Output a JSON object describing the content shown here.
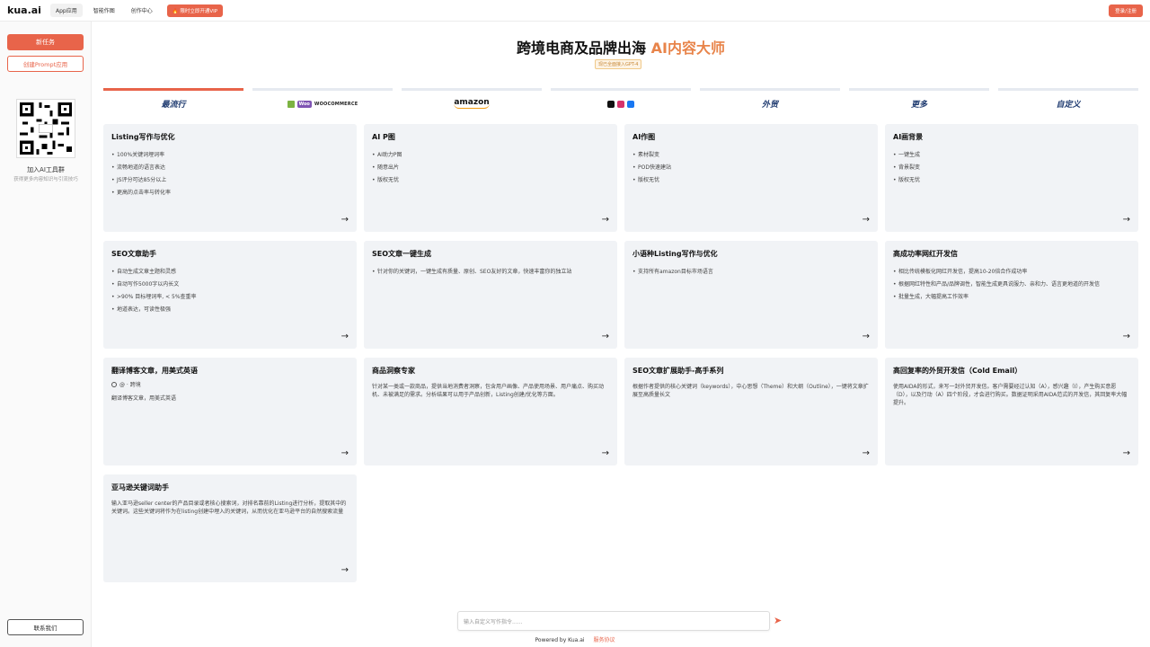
{
  "topbar": {
    "logo": "kua.ai",
    "nav": [
      "App应用",
      "智能作图",
      "创作中心"
    ],
    "vip": "🔥 限时立即开通VIP",
    "login": "登录/注册"
  },
  "sidebar": {
    "new_task": "新任务",
    "create_prompt": "创建Prompt应用",
    "join_title": "加入AI工具群",
    "join_sub": "获得更多内容知识与引流技巧",
    "contact": "联系我们"
  },
  "hero": {
    "title_main": "跨境电商及品牌出海 ",
    "title_accent": "AI内容大师",
    "badge": "现已全面接入GPT-4"
  },
  "tabs": [
    {
      "label": "最流行",
      "icon": "none"
    },
    {
      "label": "WOOCOMMERCE",
      "icon": "woocommerce-logo"
    },
    {
      "label": "amazon",
      "icon": "amazon-logo"
    },
    {
      "label": "",
      "icon": "social-icons"
    },
    {
      "label": "外贸",
      "icon": "none"
    },
    {
      "label": "更多",
      "icon": "none"
    },
    {
      "label": "自定义",
      "icon": "none"
    }
  ],
  "cards": [
    {
      "title": "Listing写作与优化",
      "bullets": [
        "100%关键词埋词率",
        "流畅地道的语言表达",
        "JS评分可达85分以上",
        "更高的点击率与转化率"
      ]
    },
    {
      "title": "AI P图",
      "bullets": [
        "AI助力P图",
        "随意出片",
        "版权无忧"
      ]
    },
    {
      "title": "AI作图",
      "bullets": [
        "素材裂变",
        "POD快速建站",
        "版权无忧"
      ]
    },
    {
      "title": "AI画背景",
      "bullets": [
        "一键生成",
        "背景裂变",
        "版权无忧"
      ]
    },
    {
      "title": "SEO文章助手",
      "bullets": [
        "自动生成文章主题和灵感",
        "自动写作5000字以内长文",
        ">90% 目标埋词率, < 5%查重率",
        "地道表达，可读性极强"
      ]
    },
    {
      "title": "SEO文章一键生成",
      "bullets": [
        "针对你的关键词，一键生成有质量、原创、SEO友好的文章，快速丰富你的独立站"
      ]
    },
    {
      "title": "小语种Listing写作与优化",
      "bullets": [
        "支持所有amazon目标市场语言"
      ]
    },
    {
      "title": "高成功率网红开发信",
      "bullets": [
        "相比传统模板化网红开发信，提高10-20倍合作成功率",
        "根据网红特性和产品/品牌调性，智能生成更具说服力、亲和力、语言更地道的开发信",
        "批量生成，大幅提高工作效率"
      ]
    },
    {
      "title": "翻译博客文章，用美式英语",
      "tag": "@ · 跨境",
      "desc": "翻译博客文章，用美式英语"
    },
    {
      "title": "商品洞察专家",
      "desc": "针对某一类或一款商品，提供当地消费者洞察，包含用户画像、产品使用场景、用户痛点、购买动机、未被满足的需求。分析结果可以用于产品创新，Listing创建/优化等方面。"
    },
    {
      "title": "SEO文章扩展助手-高手系列",
      "desc": "根据作者提供的核心关键词（keywords），中心思想（Theme）和大纲（Outline），一键将文章扩展至高质量长文"
    },
    {
      "title": "高回复率的外贸开发信（Cold Email）",
      "desc": "使用AIDA的形式，来写一封外贸开发信。客户需要经过认知（A），感兴趣（I），产生购买意愿（D），以及行动（A）四个阶段，才会进行购买。数据证明采用AIDA范式的开发信，其回复率大幅提升。"
    },
    {
      "title": "亚马逊关键词助手",
      "desc": "输入亚马逊seller center的产品目录或者核心搜索词，对排名靠前的Listing进行分析，提取其中的关键词。这些关键词将作为在listing创建中埋入的关键词，从而优化在亚马逊平台的自然搜索流量"
    }
  ],
  "input": {
    "placeholder": "输入自定义写作指令......"
  },
  "footer": {
    "powered": "Powered by Kua.ai",
    "terms": "服务协议"
  }
}
